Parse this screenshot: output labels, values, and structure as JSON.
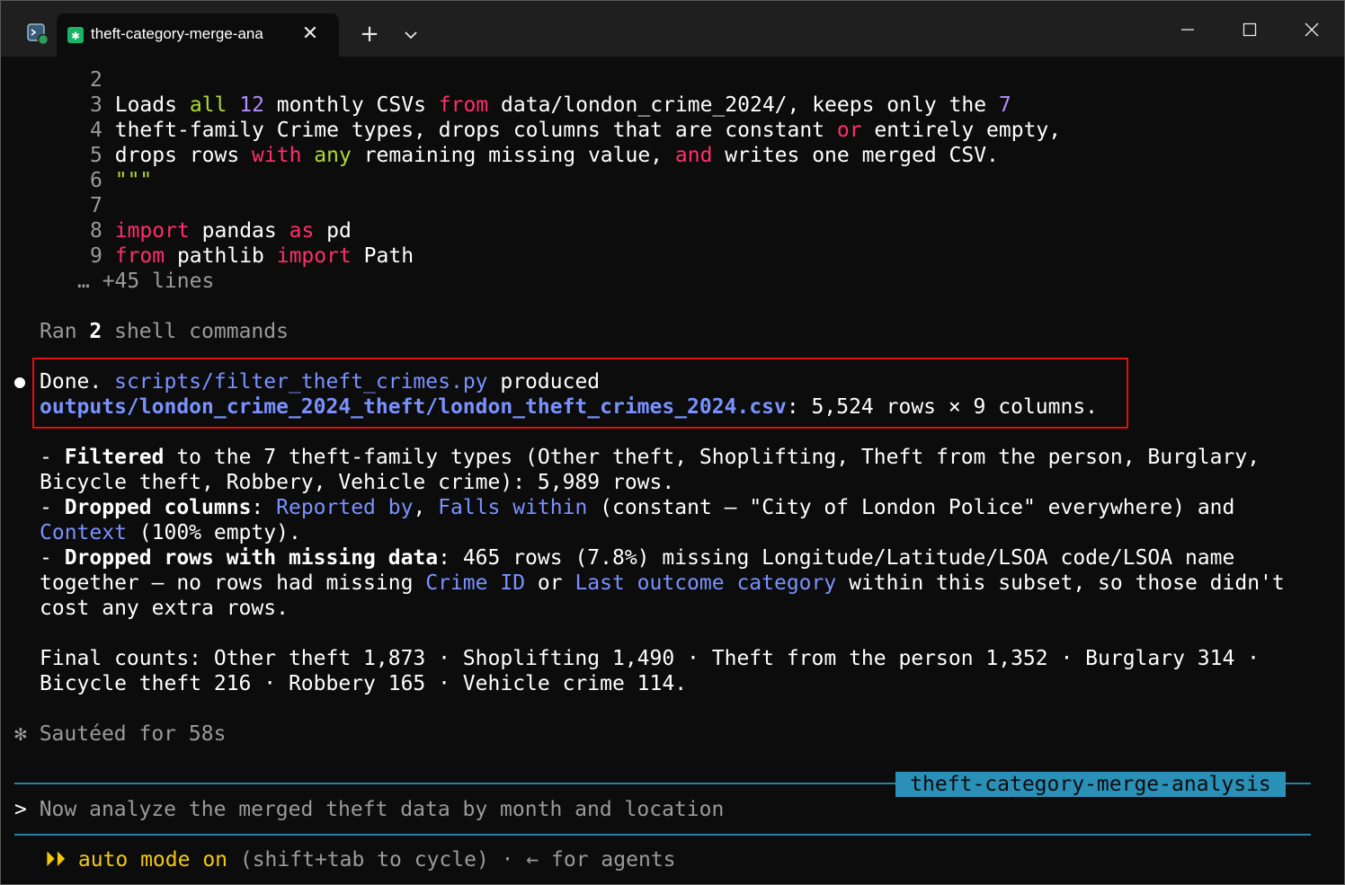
{
  "titlebar": {
    "tab_title": "theft-category-merge-ana",
    "tab_icon": "asterisk-icon",
    "new_tab": "+",
    "close_tab": "✕"
  },
  "code": {
    "lines": [
      {
        "n": "2",
        "text": ""
      },
      {
        "n": "3"
      },
      {
        "n": "4"
      },
      {
        "n": "5"
      },
      {
        "n": "6",
        "text": "\"\"\""
      },
      {
        "n": "7",
        "text": ""
      },
      {
        "n": "8"
      },
      {
        "n": "9"
      }
    ],
    "line3": {
      "a": "Loads ",
      "b": "all",
      "c": " ",
      "d": "12",
      "e": " monthly CSVs ",
      "f": "from",
      "g": " data/london_crime_2024/, keeps only the ",
      "h": "7"
    },
    "line4": {
      "a": "theft-family Crime types, drops columns that are constant ",
      "b": "or",
      "c": " entirely empty,"
    },
    "line5": {
      "a": "drops rows ",
      "b": "with",
      "c": " ",
      "d": "any",
      "e": " remaining missing value, ",
      "f": "and",
      "g": " writes one merged CSV."
    },
    "line8": {
      "a": "import",
      "b": " pandas ",
      "c": "as",
      "d": " pd"
    },
    "line9": {
      "a": "from",
      "b": " pathlib ",
      "c": "import",
      "d": " Path"
    },
    "more": "… +45 lines"
  },
  "ran": {
    "a": "Ran ",
    "b": "2",
    "c": " shell commands"
  },
  "done": {
    "a": "Done. ",
    "script": "scripts/filter_theft_crimes.py",
    "b": " produced",
    "output": "outputs/london_crime_2024_theft/london_theft_crimes_2024.csv",
    "c": ": 5,524 rows × 9 columns."
  },
  "summary": {
    "l1": {
      "a": "- ",
      "b": "Filtered",
      "c": " to the 7 theft-family types (Other theft, Shoplifting, Theft from the person, Burglary,"
    },
    "l2": "Bicycle theft, Robbery, Vehicle crime): 5,989 rows.",
    "l3": {
      "a": "- ",
      "b": "Dropped columns",
      "c": ": ",
      "d": "Reported by",
      "e": ", ",
      "f": "Falls within",
      "g": " (constant — \"City of London Police\" everywhere) and"
    },
    "l4": {
      "a": "Context",
      "b": " (100% empty)."
    },
    "l5": {
      "a": "- ",
      "b": "Dropped rows with missing data",
      "c": ": 465 rows (7.8%) missing Longitude/Latitude/LSOA code/LSOA name"
    },
    "l6": {
      "a": "together — no rows had missing ",
      "b": "Crime ID",
      "c": " or ",
      "d": "Last outcome category",
      "e": " within this subset, so those didn't"
    },
    "l7": "cost any extra rows.",
    "l8": "Final counts: Other theft 1,873 · Shoplifting 1,490 · Theft from the person 1,352 · Burglary 314 ·",
    "l9": "Bicycle theft 216 · Robbery 165 · Vehicle crime 114."
  },
  "status": {
    "spinner": "✻",
    "text": " Sautéed for 58s"
  },
  "branch_label": "theft-category-merge-analysis",
  "prompt": {
    "caret": ">",
    "placeholder": " Now analyze the merged theft data by month and location"
  },
  "footer": {
    "arrows": "⏵⏵",
    "a": " auto mode on",
    "b": " (shift+tab to cycle) · ← for agents"
  },
  "colors": {
    "keyword": "#ff2f6b",
    "function": "#b0d833",
    "number": "#b48cff",
    "link": "#7a92ff",
    "highlight_box": "#e01010",
    "separator": "#2a7fa8",
    "auto_mode": "#f2c811"
  }
}
